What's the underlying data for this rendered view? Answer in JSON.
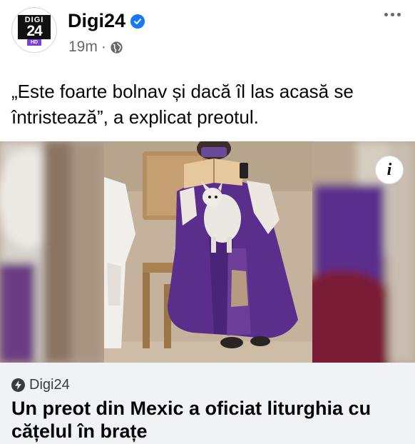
{
  "post": {
    "page_name": "Digi24",
    "time": "19m",
    "separator": "·",
    "caption": "„Este foarte bolnav și dacă îl las acasă se întristează”, a explicat preotul."
  },
  "logo": {
    "top": "DIGI",
    "number": "24",
    "badge": "HD"
  },
  "photo": {
    "info_label": "i"
  },
  "link_preview": {
    "source": "Digi24",
    "headline": "Un preot din Mexic a oficiat liturghia cu cățelul în brațe"
  },
  "icons": [
    "verified-badge-icon",
    "globe-icon",
    "more-options-icon",
    "info-icon",
    "bolt-icon"
  ],
  "colors": {
    "verified_blue": "#1877f2",
    "vestment_purple": "#5a2f8c",
    "preview_bg": "#f0f2f5",
    "meta_gray": "#65676b"
  }
}
